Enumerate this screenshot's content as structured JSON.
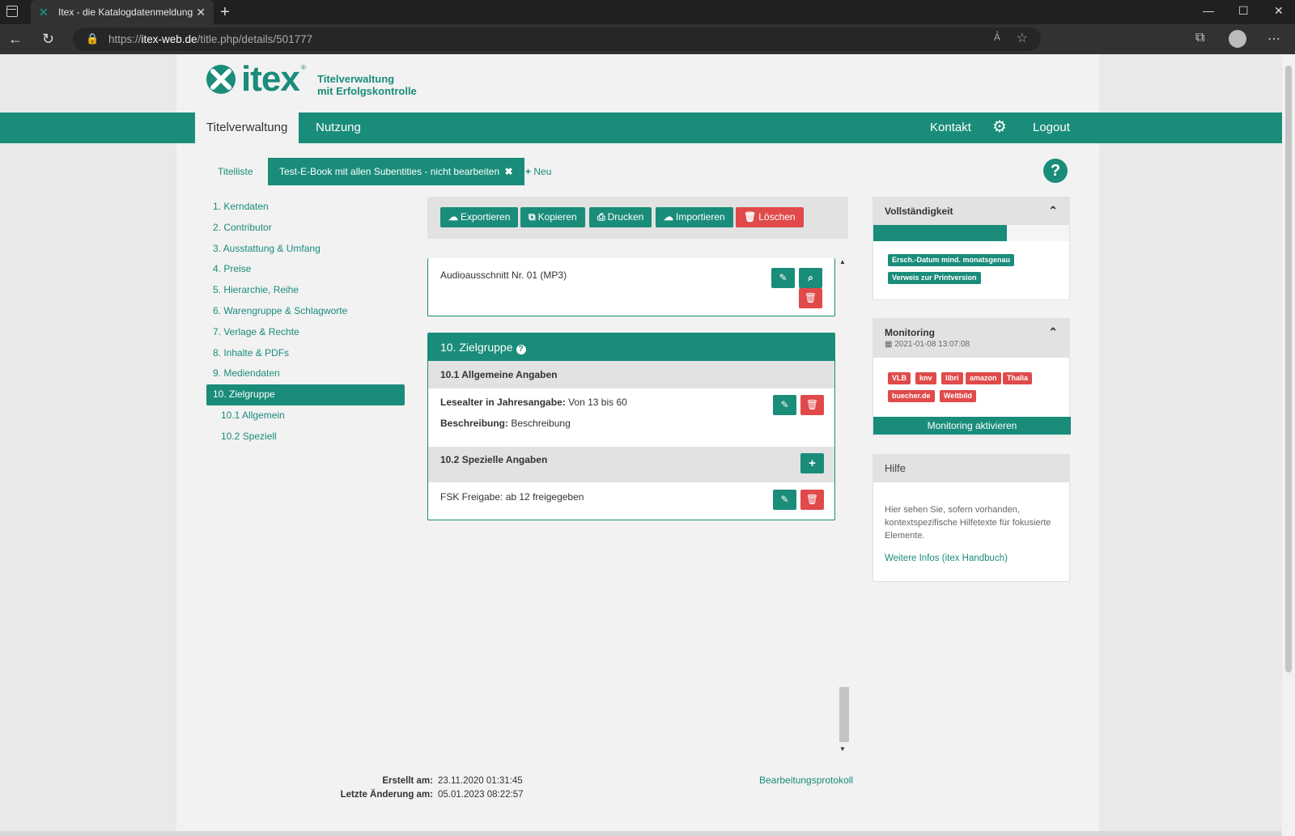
{
  "browser": {
    "tab_title": "Itex - die Katalogdatenmeldung",
    "url_prefix": "https://",
    "url_domain": "itex-web.de",
    "url_path": "/title.php/details/501777",
    "read_aloud": "A̓"
  },
  "logo": {
    "word": "itex",
    "reg": "®",
    "tagline_1": "Titelverwaltung",
    "tagline_2": "mit Erfolgskontrolle"
  },
  "mainnav": {
    "tabs": [
      {
        "label": "Titelverwaltung",
        "active": true
      },
      {
        "label": "Nutzung",
        "active": false
      }
    ],
    "kontakt": "Kontakt",
    "logout": "Logout"
  },
  "subtabs": {
    "list": "Titelliste",
    "current": "Test-E-Book mit allen Subentities - nicht bearbeiten",
    "new": "Neu"
  },
  "leftnav": {
    "items": [
      "1. Kerndaten",
      "2. Contributor",
      "3. Ausstattung & Umfang",
      "4. Preise",
      "5. Hierarchie, Reihe",
      "6. Warengruppe & Schlagworte",
      "7. Verlage & Rechte",
      "8. Inhalte & PDFs",
      "9. Mediendaten",
      "10. Zielgruppe",
      "10.1 Allgemein",
      "10.2 Speziell"
    ]
  },
  "toolbar": {
    "export": "Exportieren",
    "copy": "Kopieren",
    "print": "Drucken",
    "import": "Importieren",
    "delete": "Löschen"
  },
  "media_card": {
    "label": "Audioausschnitt  Nr. 01  (MP3)"
  },
  "zielgruppe": {
    "title": "10. Zielgruppe",
    "section1_title": "10.1 Allgemeine Angaben",
    "lesealter_key": "Lesealter in Jahresangabe:",
    "lesealter_val": "Von 13 bis 60",
    "beschreibung_key": "Beschreibung:",
    "beschreibung_val": "Beschreibung",
    "section2_title": "10.2 Spezielle Angaben",
    "fsk": "FSK Freigabe: ab 12 freigegeben"
  },
  "meta": {
    "created_key": "Erstellt am:",
    "created_val": "23.11.2020 01:31:45",
    "modified_key": "Letzte Änderung am:",
    "modified_val": "05.01.2023 08:22:57",
    "log_link": "Bearbeitungsprotokoll"
  },
  "completeness": {
    "title": "Vollständigkeit",
    "progress_fraction": 0.68,
    "badges": [
      "Ersch.-Datum mind. monatsgenau",
      "Verweis zur Printversion"
    ]
  },
  "monitoring": {
    "title": "Monitoring",
    "date": "2021-01-08 13:07:08",
    "badges": [
      "VLB",
      "knv",
      "libri",
      "amazon",
      "Thalia",
      "buecher.de",
      "Weltbild"
    ],
    "button": "Monitoring aktivieren"
  },
  "hilfe": {
    "title": "Hilfe",
    "text": "Hier sehen Sie, sofern vorhanden, kontextspezifische Hilfetexte für fokusierte Elemente.",
    "link": "Weitere Infos (itex Handbuch)"
  },
  "colors": {
    "brand": "#1a8c7a",
    "danger": "#e04a4a"
  },
  "icons": {
    "pencil": "✎",
    "search": "⌕",
    "trash": "🗑",
    "plus": "+"
  }
}
